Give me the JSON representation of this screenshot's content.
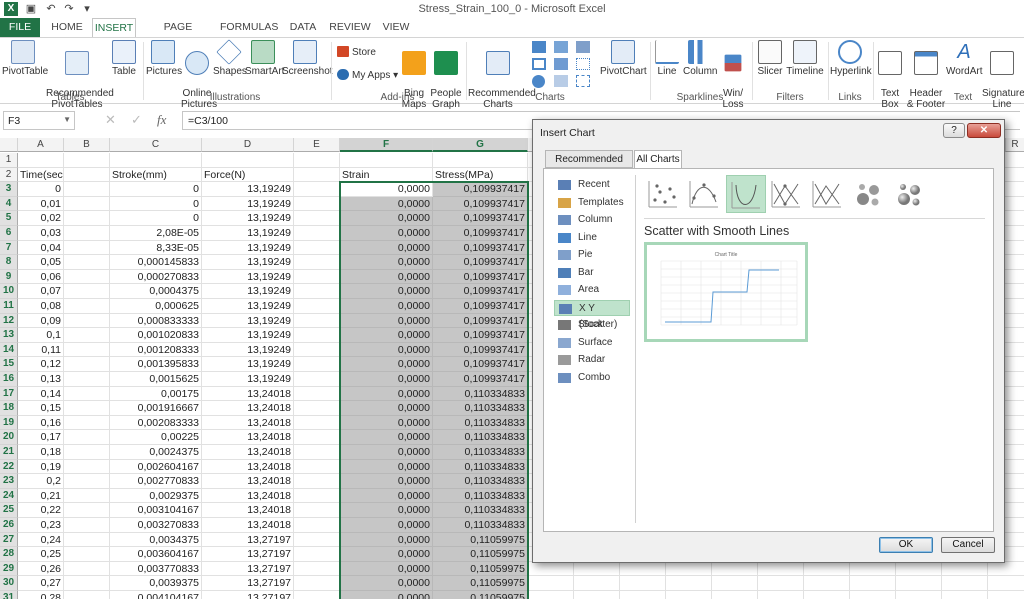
{
  "window": {
    "title": "Stress_Strain_100_0 - Microsoft Excel",
    "help_label": "?",
    "restore_label": "□",
    "close_label": "✕",
    "undo_glyph": "↶",
    "redo_glyph": "↷"
  },
  "tabs": [
    "FILE",
    "HOME",
    "INSERT",
    "PAGE LAYOUT",
    "FORMULAS",
    "DATA",
    "REVIEW",
    "VIEW"
  ],
  "active_tab": "INSERT",
  "ribbon": {
    "tables": {
      "pivottable": "PivotTable",
      "recommended_pivot": "Recommended\nPivotTables",
      "table": "Table",
      "group": "Tables"
    },
    "illustrations": {
      "pictures": "Pictures",
      "online_pictures": "Online\nPictures",
      "shapes": "Shapes",
      "smartart": "SmartArt",
      "screenshot": "Screenshot",
      "group": "Illustrations"
    },
    "addins": {
      "store": "Store",
      "my_apps": "My Apps",
      "bing_maps": "Bing\nMaps",
      "people_graph": "People\nGraph",
      "group": "Add-ins"
    },
    "charts": {
      "recommended": "Recommended\nCharts",
      "pivotchart": "PivotChart",
      "group": "Charts"
    },
    "sparklines": {
      "line": "Line",
      "column": "Column",
      "winloss": "Win/\nLoss",
      "group": "Sparklines"
    },
    "filters": {
      "slicer": "Slicer",
      "timeline": "Timeline",
      "group": "Filters"
    },
    "links": {
      "hyperlink": "Hyperlink",
      "group": "Links"
    },
    "text": {
      "textbox": "Text\nBox",
      "header_footer": "Header\n& Footer",
      "wordart": "WordArt",
      "signature": "Signature\nLine",
      "group": "Text"
    }
  },
  "formula_bar": {
    "name_box": "F3",
    "formula": "=C3/100",
    "fx_label": "fx",
    "cancel_glyph": "✕",
    "enter_glyph": "✓"
  },
  "columns": [
    "A",
    "B",
    "C",
    "D",
    "E",
    "F",
    "G"
  ],
  "extra_columns": [
    "R"
  ],
  "header_row": {
    "A": "Time(sec)",
    "C": "Stroke(mm)",
    "D": "Force(N)",
    "F": "Strain",
    "G": "Stress(MPa)"
  },
  "rows": [
    {
      "n": "1",
      "A": "",
      "C": "",
      "D": "",
      "F": "",
      "G": ""
    },
    {
      "n": "2",
      "A": "Time(sec)",
      "C": "Stroke(mm)",
      "D": "Force(N)",
      "F": "Strain",
      "G": "Stress(MPa)"
    },
    {
      "n": "3",
      "A": "0",
      "C": "0",
      "D": "13,19249",
      "F": "0,0000",
      "G": "0,109937417"
    },
    {
      "n": "4",
      "A": "0,01",
      "C": "0",
      "D": "13,19249",
      "F": "0,0000",
      "G": "0,109937417"
    },
    {
      "n": "5",
      "A": "0,02",
      "C": "0",
      "D": "13,19249",
      "F": "0,0000",
      "G": "0,109937417"
    },
    {
      "n": "6",
      "A": "0,03",
      "C": "2,08E-05",
      "D": "13,19249",
      "F": "0,0000",
      "G": "0,109937417"
    },
    {
      "n": "7",
      "A": "0,04",
      "C": "8,33E-05",
      "D": "13,19249",
      "F": "0,0000",
      "G": "0,109937417"
    },
    {
      "n": "8",
      "A": "0,05",
      "C": "0,000145833",
      "D": "13,19249",
      "F": "0,0000",
      "G": "0,109937417"
    },
    {
      "n": "9",
      "A": "0,06",
      "C": "0,000270833",
      "D": "13,19249",
      "F": "0,0000",
      "G": "0,109937417"
    },
    {
      "n": "10",
      "A": "0,07",
      "C": "0,0004375",
      "D": "13,19249",
      "F": "0,0000",
      "G": "0,109937417"
    },
    {
      "n": "11",
      "A": "0,08",
      "C": "0,000625",
      "D": "13,19249",
      "F": "0,0000",
      "G": "0,109937417"
    },
    {
      "n": "12",
      "A": "0,09",
      "C": "0,000833333",
      "D": "13,19249",
      "F": "0,0000",
      "G": "0,109937417"
    },
    {
      "n": "13",
      "A": "0,1",
      "C": "0,001020833",
      "D": "13,19249",
      "F": "0,0000",
      "G": "0,109937417"
    },
    {
      "n": "14",
      "A": "0,11",
      "C": "0,001208333",
      "D": "13,19249",
      "F": "0,0000",
      "G": "0,109937417"
    },
    {
      "n": "15",
      "A": "0,12",
      "C": "0,001395833",
      "D": "13,19249",
      "F": "0,0000",
      "G": "0,109937417"
    },
    {
      "n": "16",
      "A": "0,13",
      "C": "0,0015625",
      "D": "13,19249",
      "F": "0,0000",
      "G": "0,109937417"
    },
    {
      "n": "17",
      "A": "0,14",
      "C": "0,00175",
      "D": "13,24018",
      "F": "0,0000",
      "G": "0,110334833"
    },
    {
      "n": "18",
      "A": "0,15",
      "C": "0,001916667",
      "D": "13,24018",
      "F": "0,0000",
      "G": "0,110334833"
    },
    {
      "n": "19",
      "A": "0,16",
      "C": "0,002083333",
      "D": "13,24018",
      "F": "0,0000",
      "G": "0,110334833"
    },
    {
      "n": "20",
      "A": "0,17",
      "C": "0,00225",
      "D": "13,24018",
      "F": "0,0000",
      "G": "0,110334833"
    },
    {
      "n": "21",
      "A": "0,18",
      "C": "0,0024375",
      "D": "13,24018",
      "F": "0,0000",
      "G": "0,110334833"
    },
    {
      "n": "22",
      "A": "0,19",
      "C": "0,002604167",
      "D": "13,24018",
      "F": "0,0000",
      "G": "0,110334833"
    },
    {
      "n": "23",
      "A": "0,2",
      "C": "0,002770833",
      "D": "13,24018",
      "F": "0,0000",
      "G": "0,110334833"
    },
    {
      "n": "24",
      "A": "0,21",
      "C": "0,0029375",
      "D": "13,24018",
      "F": "0,0000",
      "G": "0,110334833"
    },
    {
      "n": "25",
      "A": "0,22",
      "C": "0,003104167",
      "D": "13,24018",
      "F": "0,0000",
      "G": "0,110334833"
    },
    {
      "n": "26",
      "A": "0,23",
      "C": "0,003270833",
      "D": "13,24018",
      "F": "0,0000",
      "G": "0,110334833"
    },
    {
      "n": "27",
      "A": "0,24",
      "C": "0,0034375",
      "D": "13,27197",
      "F": "0,0000",
      "G": "0,11059975"
    },
    {
      "n": "28",
      "A": "0,25",
      "C": "0,003604167",
      "D": "13,27197",
      "F": "0,0000",
      "G": "0,11059975"
    },
    {
      "n": "29",
      "A": "0,26",
      "C": "0,003770833",
      "D": "13,27197",
      "F": "0,0000",
      "G": "0,11059975"
    },
    {
      "n": "30",
      "A": "0,27",
      "C": "0,0039375",
      "D": "13,27197",
      "F": "0,0000",
      "G": "0,11059975"
    },
    {
      "n": "31",
      "A": "0,28",
      "C": "0,004104167",
      "D": "13,27197",
      "F": "0,0000",
      "G": "0,11059975"
    }
  ],
  "selection": {
    "range": "F3:G31",
    "active_cell": "F3"
  },
  "dialog": {
    "title": "Insert Chart",
    "help": "?",
    "close": "✕",
    "tabs": [
      "Recommended Charts",
      "All Charts"
    ],
    "active_tab": "All Charts",
    "chart_types": [
      "Recent",
      "Templates",
      "Column",
      "Line",
      "Pie",
      "Bar",
      "Area",
      "X Y (Scatter)",
      "Stock",
      "Surface",
      "Radar",
      "Combo"
    ],
    "selected_type": "X Y (Scatter)",
    "subtypes": [
      "Scatter",
      "Scatter with Smooth Lines and Markers",
      "Scatter with Smooth Lines",
      "Scatter with Straight Lines and Markers",
      "Scatter with Straight Lines",
      "Bubble",
      "3-D Bubble"
    ],
    "selected_subtype_index": 2,
    "subtype_title": "Scatter with Smooth Lines",
    "preview_title": "Chart Title",
    "ok": "OK",
    "cancel": "Cancel"
  },
  "colors": {
    "excel_green": "#217346",
    "selection_fill": "#c6c6c6",
    "dialog_highlight": "#bfe3cc",
    "series": "#5b9bd5"
  }
}
